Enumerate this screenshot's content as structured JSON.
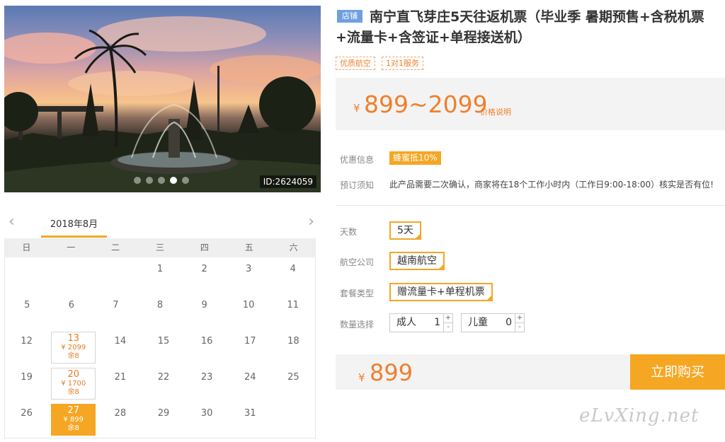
{
  "gallery": {
    "image_id": "ID:2624059",
    "slide_count": 5,
    "active_slide": 4
  },
  "calendar": {
    "month": "2018年8月",
    "prev_icon": "chevron-left-icon",
    "next_icon": "chevron-right-icon",
    "weekdays": [
      "日",
      "一",
      "二",
      "三",
      "四",
      "五",
      "六"
    ],
    "weeks": [
      [
        {
          "day": ""
        },
        {
          "day": ""
        },
        {
          "day": ""
        },
        {
          "day": "1"
        },
        {
          "day": "2"
        },
        {
          "day": "3"
        },
        {
          "day": "4"
        }
      ],
      [
        {
          "day": "5"
        },
        {
          "day": "6"
        },
        {
          "day": "7"
        },
        {
          "day": "8"
        },
        {
          "day": "9"
        },
        {
          "day": "10"
        },
        {
          "day": "11"
        }
      ],
      [
        {
          "day": "12"
        },
        {
          "day": "13",
          "price": "¥ 2099",
          "left": "余8"
        },
        {
          "day": "14"
        },
        {
          "day": "15"
        },
        {
          "day": "16"
        },
        {
          "day": "17"
        },
        {
          "day": "18"
        }
      ],
      [
        {
          "day": "19"
        },
        {
          "day": "20",
          "price": "¥ 1700",
          "left": "余8"
        },
        {
          "day": "21"
        },
        {
          "day": "22"
        },
        {
          "day": "23"
        },
        {
          "day": "24"
        },
        {
          "day": "25"
        }
      ],
      [
        {
          "day": "26"
        },
        {
          "day": "27",
          "price": "¥ 899",
          "left": "余8",
          "selected": true
        },
        {
          "day": "28"
        },
        {
          "day": "29"
        },
        {
          "day": "30"
        },
        {
          "day": "31"
        },
        {
          "day": ""
        }
      ]
    ]
  },
  "product": {
    "store_badge": "店铺",
    "title": "南宁直飞芽庄5天往返机票（毕业季 暑期预售+含税机票+流量卡+含签证+单程接送机）",
    "tags": [
      "优质航空",
      "1对1服务"
    ],
    "price_currency": "¥",
    "price_range": "899~2099",
    "price_note": "价格说明"
  },
  "info": {
    "discount_label": "优惠信息",
    "discount_value": "蜂蜜抵10%",
    "notice_label": "预订须知",
    "notice_value": "此产品需要二次确认，商家将在18个工作小时内（工作日9:00-18:00）核实是否有位!"
  },
  "options": {
    "days_label": "天数",
    "days_value": "5天",
    "airline_label": "航空公司",
    "airline_value": "越南航空",
    "package_label": "套餐类型",
    "package_value": "赠流量卡+单程机票",
    "check_icon": "✓",
    "qty_label": "数量选择",
    "adult_label": "成人",
    "adult_value": "1",
    "child_label": "儿童",
    "child_value": "0",
    "plus": "+",
    "minus": "-"
  },
  "buy": {
    "currency": "¥",
    "price": "899",
    "button": "立即购买"
  },
  "watermark": "eLvXing.net",
  "colors": {
    "accent": "#f5a623",
    "price": "#f07f2c",
    "badge": "#6f9fe0"
  }
}
